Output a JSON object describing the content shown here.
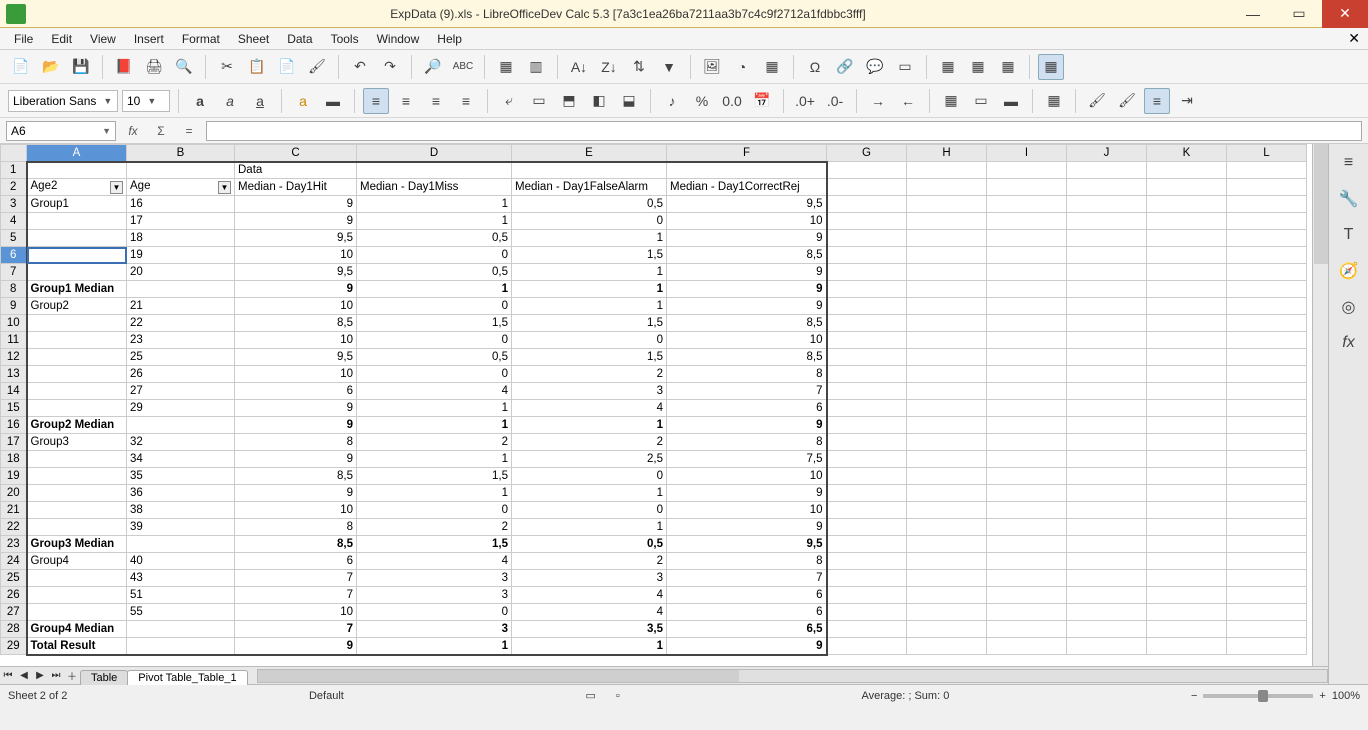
{
  "titlebar": {
    "text": "ExpData (9).xls - LibreOfficeDev Calc 5.3 [7a3c1ea26ba7211aa3b7c4c9f2712a1fdbbc3fff]"
  },
  "menu": {
    "file": "File",
    "edit": "Edit",
    "view": "View",
    "insert": "Insert",
    "format": "Format",
    "sheet": "Sheet",
    "data": "Data",
    "tools": "Tools",
    "window": "Window",
    "help": "Help"
  },
  "font": {
    "name": "Liberation Sans",
    "size": "10"
  },
  "cellref": "A6",
  "cols": [
    "A",
    "B",
    "C",
    "D",
    "E",
    "F",
    "G",
    "H",
    "I",
    "J",
    "K",
    "L"
  ],
  "headers": {
    "data_label": "Data",
    "age2": "Age2",
    "age": "Age",
    "c": "Median - Day1Hit",
    "d": "Median - Day1Miss",
    "e": "Median - Day1FalseAlarm",
    "f": "Median - Day1CorrectRej"
  },
  "rows": [
    {
      "n": 3,
      "a": "Group1",
      "b": "16",
      "c": "9",
      "d": "1",
      "e": "0,5",
      "f": "9,5"
    },
    {
      "n": 4,
      "a": "",
      "b": "17",
      "c": "9",
      "d": "1",
      "e": "0",
      "f": "10"
    },
    {
      "n": 5,
      "a": "",
      "b": "18",
      "c": "9,5",
      "d": "0,5",
      "e": "1",
      "f": "9"
    },
    {
      "n": 6,
      "a": "",
      "b": "19",
      "c": "10",
      "d": "0",
      "e": "1,5",
      "f": "8,5",
      "sel": true
    },
    {
      "n": 7,
      "a": "",
      "b": "20",
      "c": "9,5",
      "d": "0,5",
      "e": "1",
      "f": "9"
    },
    {
      "n": 8,
      "a": "Group1 Median",
      "b": "",
      "c": "9",
      "d": "1",
      "e": "1",
      "f": "9",
      "bold": true
    },
    {
      "n": 9,
      "a": "Group2",
      "b": "21",
      "c": "10",
      "d": "0",
      "e": "1",
      "f": "9"
    },
    {
      "n": 10,
      "a": "",
      "b": "22",
      "c": "8,5",
      "d": "1,5",
      "e": "1,5",
      "f": "8,5"
    },
    {
      "n": 11,
      "a": "",
      "b": "23",
      "c": "10",
      "d": "0",
      "e": "0",
      "f": "10"
    },
    {
      "n": 12,
      "a": "",
      "b": "25",
      "c": "9,5",
      "d": "0,5",
      "e": "1,5",
      "f": "8,5"
    },
    {
      "n": 13,
      "a": "",
      "b": "26",
      "c": "10",
      "d": "0",
      "e": "2",
      "f": "8"
    },
    {
      "n": 14,
      "a": "",
      "b": "27",
      "c": "6",
      "d": "4",
      "e": "3",
      "f": "7"
    },
    {
      "n": 15,
      "a": "",
      "b": "29",
      "c": "9",
      "d": "1",
      "e": "4",
      "f": "6"
    },
    {
      "n": 16,
      "a": "Group2 Median",
      "b": "",
      "c": "9",
      "d": "1",
      "e": "1",
      "f": "9",
      "bold": true
    },
    {
      "n": 17,
      "a": "Group3",
      "b": "32",
      "c": "8",
      "d": "2",
      "e": "2",
      "f": "8"
    },
    {
      "n": 18,
      "a": "",
      "b": "34",
      "c": "9",
      "d": "1",
      "e": "2,5",
      "f": "7,5"
    },
    {
      "n": 19,
      "a": "",
      "b": "35",
      "c": "8,5",
      "d": "1,5",
      "e": "0",
      "f": "10"
    },
    {
      "n": 20,
      "a": "",
      "b": "36",
      "c": "9",
      "d": "1",
      "e": "1",
      "f": "9"
    },
    {
      "n": 21,
      "a": "",
      "b": "38",
      "c": "10",
      "d": "0",
      "e": "0",
      "f": "10"
    },
    {
      "n": 22,
      "a": "",
      "b": "39",
      "c": "8",
      "d": "2",
      "e": "1",
      "f": "9"
    },
    {
      "n": 23,
      "a": "Group3 Median",
      "b": "",
      "c": "8,5",
      "d": "1,5",
      "e": "0,5",
      "f": "9,5",
      "bold": true
    },
    {
      "n": 24,
      "a": "Group4",
      "b": "40",
      "c": "6",
      "d": "4",
      "e": "2",
      "f": "8"
    },
    {
      "n": 25,
      "a": "",
      "b": "43",
      "c": "7",
      "d": "3",
      "e": "3",
      "f": "7"
    },
    {
      "n": 26,
      "a": "",
      "b": "51",
      "c": "7",
      "d": "3",
      "e": "4",
      "f": "6"
    },
    {
      "n": 27,
      "a": "",
      "b": "55",
      "c": "10",
      "d": "0",
      "e": "4",
      "f": "6"
    },
    {
      "n": 28,
      "a": "Group4 Median",
      "b": "",
      "c": "7",
      "d": "3",
      "e": "3,5",
      "f": "6,5",
      "bold": true
    },
    {
      "n": 29,
      "a": "Total Result",
      "b": "",
      "c": "9",
      "d": "1",
      "e": "1",
      "f": "9",
      "bold": true
    }
  ],
  "tabs": {
    "t1": "Table",
    "t2": "Pivot Table_Table_1"
  },
  "status": {
    "sheet": "Sheet 2 of 2",
    "style": "Default",
    "summary": "Average: ; Sum: 0",
    "zoom": "100%"
  }
}
